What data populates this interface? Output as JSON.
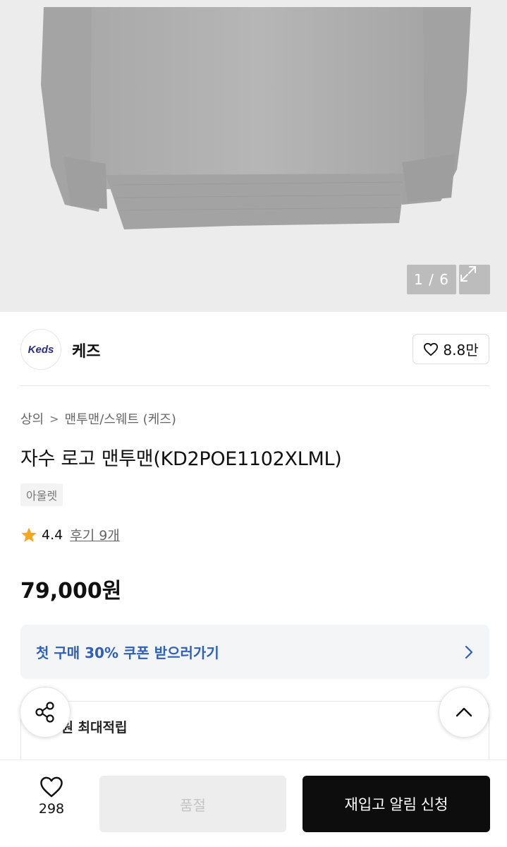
{
  "gallery": {
    "counter": "1 / 6",
    "icons": {
      "expand": "expand-icon"
    }
  },
  "brand": {
    "logo_text": "Keds",
    "name": "케즈",
    "like_count": "8.8만",
    "like_icon": "heart-outline-icon"
  },
  "breadcrumb": {
    "items": [
      "상의",
      "맨투맨/스웨트 (케즈)"
    ],
    "separator": ">"
  },
  "product": {
    "title": "자수 로고 맨투맨(KD2POE1102XLML)",
    "tag": "아울렛",
    "rating": "4.4",
    "review_link": "후기 9개",
    "price": "79,000원"
  },
  "coupon": {
    "text": "첫 구매 30% 쿠폰 받으러가기",
    "icon": "chevron-right-icon"
  },
  "points": {
    "text": "00원 최대적립"
  },
  "floating": {
    "share_icon": "share-icon",
    "scroll_top_icon": "chevron-up-icon"
  },
  "bottom_bar": {
    "wish_count": "298",
    "soldout_label": "품절",
    "restock_label": "재입고 알림 신청"
  },
  "colors": {
    "accent_blue": "#2e5fba",
    "star": "#f5a623",
    "primary_button": "#0d0d0d"
  }
}
